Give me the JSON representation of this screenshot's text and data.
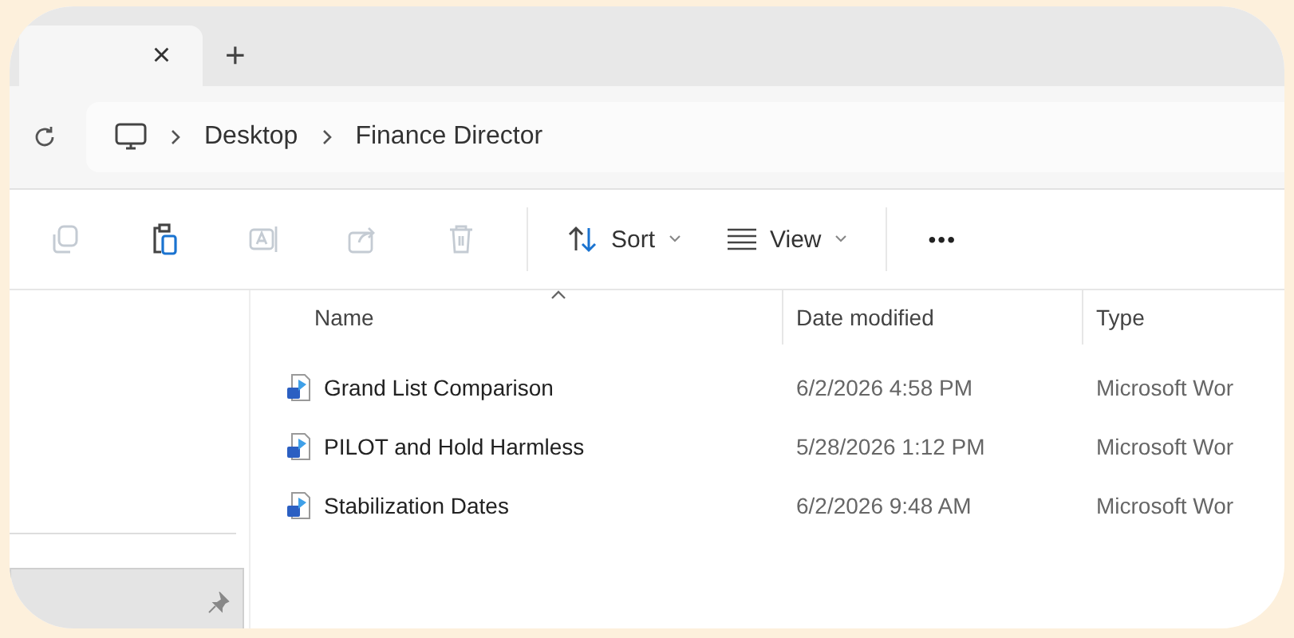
{
  "tabs": [
    {
      "close": "×",
      "selected": true
    }
  ],
  "new_tab": "+",
  "breadcrumb": [
    "Desktop",
    "Finance Director"
  ],
  "toolbar": [
    {
      "kind": "copy",
      "disabled": true
    },
    {
      "kind": "paste",
      "disabled": false
    },
    {
      "kind": "rename",
      "disabled": true
    },
    {
      "kind": "share",
      "disabled": true
    },
    {
      "kind": "delete",
      "disabled": true
    }
  ],
  "menus": [
    {
      "kind": "sort",
      "label": "Sort"
    },
    {
      "kind": "view",
      "label": "View"
    }
  ],
  "more": "•••",
  "columns": [
    "Name",
    "Date modified",
    "Type"
  ],
  "rows": [
    {
      "name": "Grand List Comparison",
      "date": "6/2/2026 4:58 PM",
      "type": "Microsoft Wor"
    },
    {
      "name": "PILOT and Hold Harmless",
      "date": "5/28/2026 1:12 PM",
      "type": "Microsoft Wor"
    },
    {
      "name": "Stabilization Dates",
      "date": "6/2/2026 9:48 AM",
      "type": "Microsoft Wor"
    }
  ]
}
